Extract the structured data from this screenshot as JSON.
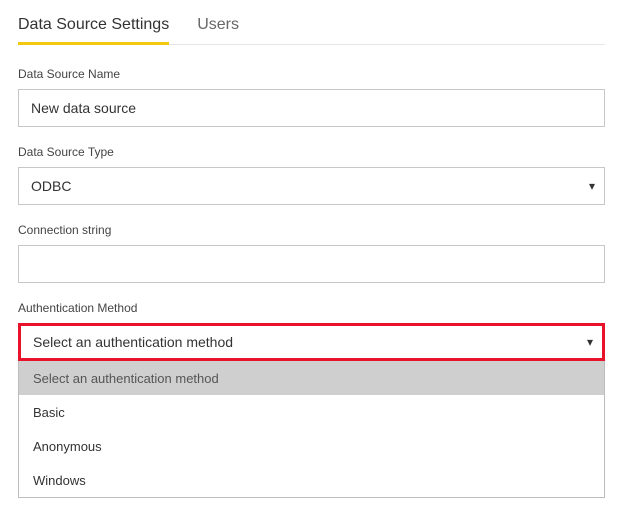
{
  "tabs": {
    "settings": "Data Source Settings",
    "users": "Users"
  },
  "fields": {
    "name": {
      "label": "Data Source Name",
      "value": "New data source"
    },
    "type": {
      "label": "Data Source Type",
      "value": "ODBC"
    },
    "connstr": {
      "label": "Connection string",
      "value": ""
    },
    "auth": {
      "label": "Authentication Method",
      "value": "Select an authentication method",
      "options": {
        "placeholder": "Select an authentication method",
        "basic": "Basic",
        "anonymous": "Anonymous",
        "windows": "Windows"
      }
    }
  }
}
